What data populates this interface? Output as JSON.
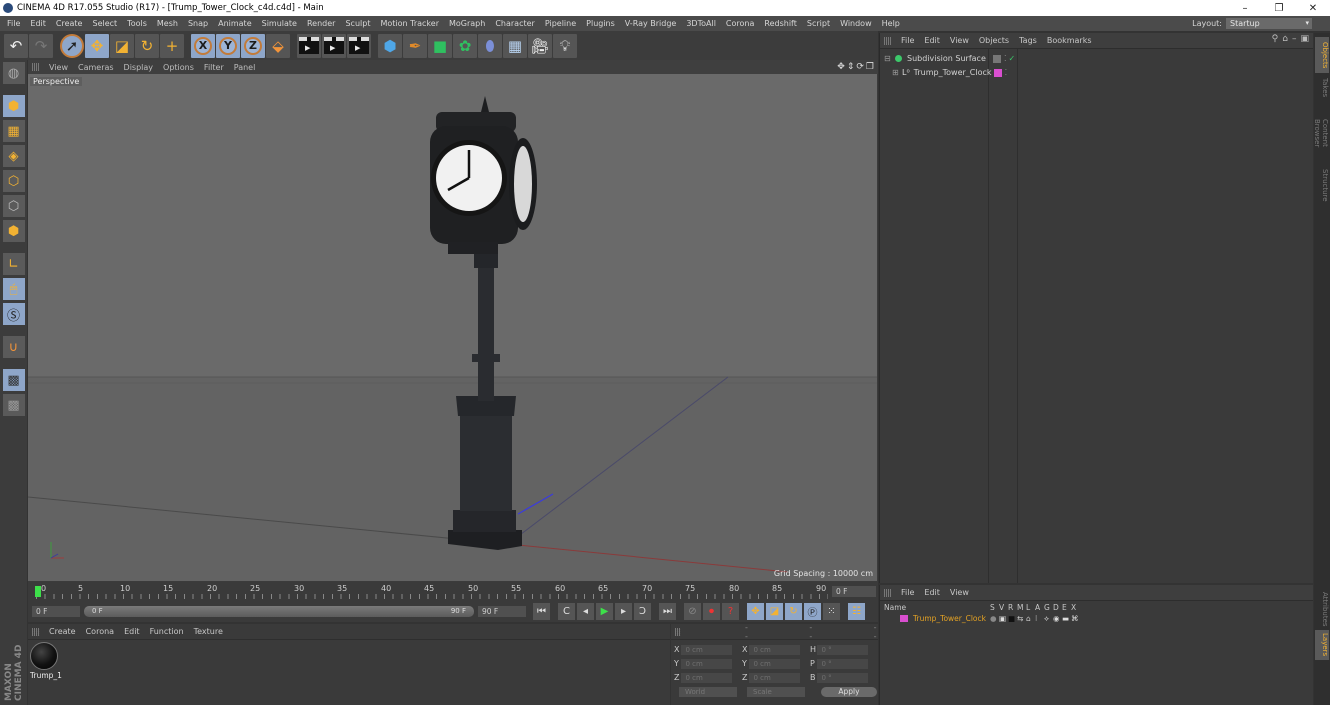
{
  "window": {
    "title": "CINEMA 4D R17.055 Studio (R17) - [Trump_Tower_Clock_c4d.c4d] - Main",
    "controls": [
      "minimize-icon",
      "restore-icon",
      "close-icon"
    ]
  },
  "menubar": {
    "items": [
      "File",
      "Edit",
      "Create",
      "Select",
      "Tools",
      "Mesh",
      "Snap",
      "Animate",
      "Simulate",
      "Render",
      "Sculpt",
      "Motion Tracker",
      "MoGraph",
      "Character",
      "Pipeline",
      "Plugins",
      "V-Ray Bridge",
      "3DToAll",
      "Corona",
      "Redshift",
      "Script",
      "Window",
      "Help"
    ],
    "layout_label": "Layout:",
    "layout_value": "Startup"
  },
  "toolbar": {
    "tools": [
      "undo",
      "redo",
      "live-selection",
      "move",
      "scale",
      "rotate",
      "add-object",
      "x-axis-lock",
      "y-axis-lock",
      "z-axis-lock",
      "coordinate-system",
      "render-view",
      "render-to-picture-viewer",
      "edit-render-settings",
      "cube",
      "pen-spline",
      "subdivision-surface",
      "cloner",
      "deformer",
      "floor",
      "camera",
      "light"
    ],
    "axis_labels": [
      "X",
      "Y",
      "Z"
    ]
  },
  "left_tools": [
    "make-editable",
    "model-mode",
    "texture-mode",
    "workplane-mode",
    "points-mode",
    "edges-mode",
    "polygons-mode",
    "enable-axis",
    "tweak-mode",
    "snap",
    "magnet",
    "lock-workplane",
    "quantize"
  ],
  "viewport": {
    "menu": [
      "View",
      "Cameras",
      "Display",
      "Options",
      "Filter",
      "Panel"
    ],
    "camera_label": "Perspective",
    "grid_spacing": "Grid Spacing : 10000 cm",
    "colors": {
      "background": "#6b6b6b",
      "floor_line": "#5f5f5f"
    }
  },
  "timeline": {
    "ruler_labels": [
      "0",
      "5",
      "10",
      "15",
      "20",
      "25",
      "30",
      "35",
      "40",
      "45",
      "50",
      "55",
      "60",
      "65",
      "70",
      "75",
      "80",
      "85",
      "90"
    ],
    "current_frame": "0 F",
    "start_frame": "0 F",
    "range_start": "0 F",
    "range_end": "90 F",
    "end_frame": "90 F",
    "playback_buttons": [
      "go-to-start",
      "previous-key",
      "previous-frame",
      "play-forward",
      "next-frame",
      "next-key",
      "go-to-end"
    ],
    "key_buttons": [
      "record-active",
      "autokey",
      "keyframe-selection",
      "key-position",
      "key-scale",
      "key-rotation",
      "key-parameter",
      "key-pla",
      "timeline-window"
    ]
  },
  "materials": {
    "menu": [
      "Create",
      "Corona",
      "Edit",
      "Function",
      "Texture"
    ],
    "items": [
      {
        "name": "Trump_1"
      }
    ]
  },
  "coordinates": {
    "headers": [
      "--",
      "--",
      "--"
    ],
    "rows": [
      {
        "a": "X",
        "av": "0 cm",
        "b": "X",
        "bv": "0 cm",
        "c": "H",
        "cv": "0 °"
      },
      {
        "a": "Y",
        "av": "0 cm",
        "b": "Y",
        "bv": "0 cm",
        "c": "P",
        "cv": "0 °"
      },
      {
        "a": "Z",
        "av": "0 cm",
        "b": "Z",
        "bv": "0 cm",
        "c": "B",
        "cv": "0 °"
      }
    ],
    "space": "World",
    "mode": "Scale",
    "apply_label": "Apply"
  },
  "objects": {
    "menu": [
      "File",
      "Edit",
      "View",
      "Objects",
      "Tags",
      "Bookmarks"
    ],
    "items": [
      {
        "name": "Subdivision Surface",
        "color": "#3cc86a"
      },
      {
        "name": "Trump_Tower_Clock",
        "tag_color": "#d94fd0"
      }
    ]
  },
  "layers": {
    "menu": [
      "File",
      "Edit",
      "View"
    ],
    "columns": [
      "Name",
      "S",
      "V",
      "R",
      "M",
      "L",
      "A",
      "G",
      "D",
      "E",
      "X"
    ],
    "rows": [
      {
        "name": "Trump_Tower_Clock",
        "color": "#d94fd0",
        "text_color": "#e5a324"
      }
    ]
  },
  "side_tabs": {
    "top": [
      "Objects",
      "Takes",
      "Content Browser",
      "Structure"
    ],
    "bottom": [
      "Attributes",
      "Layers"
    ]
  },
  "branding": "MAXON CINEMA 4D"
}
